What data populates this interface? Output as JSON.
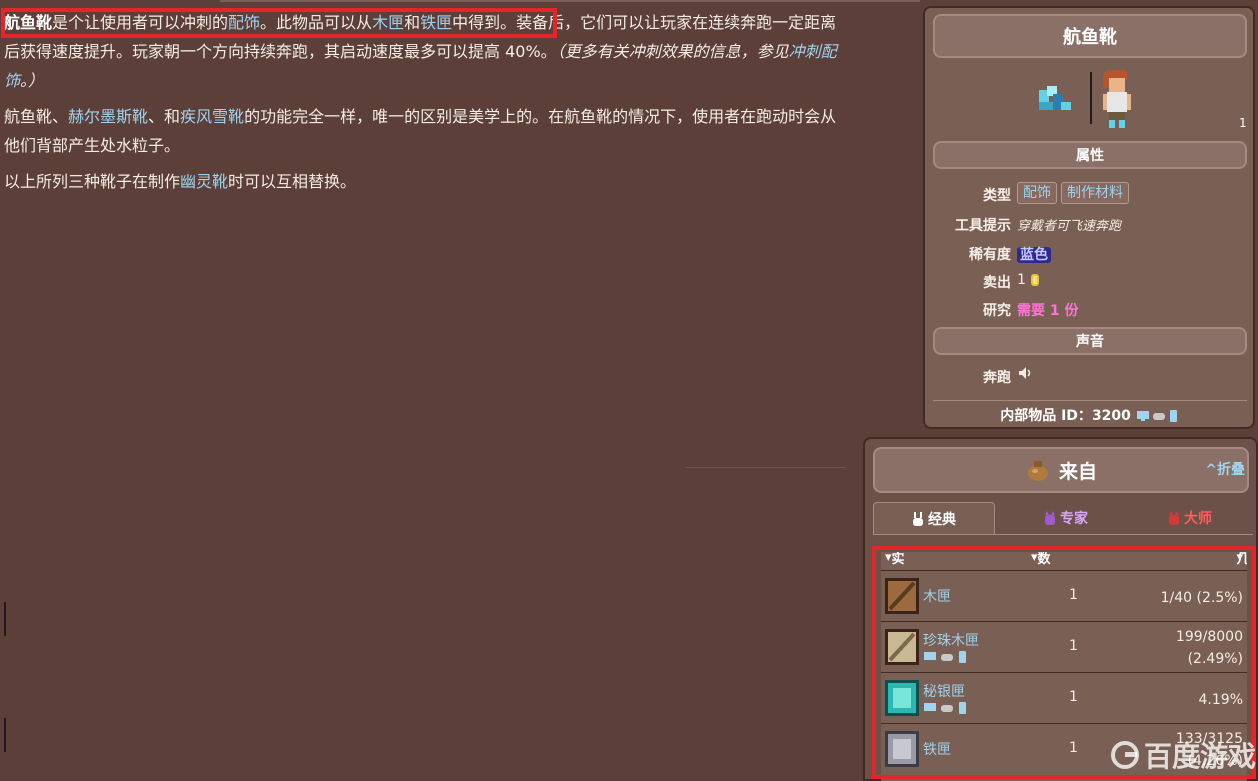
{
  "article": {
    "p1": {
      "item_name": "航鱼靴",
      "t1": "是个让使用者可以冲刺的",
      "link_accessory": "配饰",
      "t2": "。此物品可以从",
      "link_wooden_crate": "木匣",
      "t3": "和",
      "link_iron_crate": "铁匣",
      "t4": "中得到。装备后，它们可以让玩家在连续奔跑一定距离后获得速度提升。玩家朝一个方向持续奔跑，其启动速度最多可以提高 40%。",
      "note_prefix": "（更多有关冲刺效果的信息，参见",
      "note_link": "冲刺配饰",
      "note_suffix": "。）"
    },
    "p2": {
      "t1": "航鱼靴、",
      "link_hermes": "赫尔墨斯靴",
      "t2": "、和",
      "link_flurry": "疾风雪靴",
      "t3": "的功能完全一样，唯一的区别是美学上的。在航鱼靴的情况下，使用者在跑动时会从他们背部产生处水粒子。"
    },
    "p3": {
      "t1": "以上所列三种靴子在制作",
      "link_spectre": "幽灵靴",
      "t2": "时可以互相替换。"
    }
  },
  "infobox": {
    "title": "航鱼靴",
    "images_note": "1",
    "section_props": "属性",
    "type_label": "类型",
    "type_tags": [
      "配饰",
      "制作材料"
    ],
    "tooltip_label": "工具提示",
    "tooltip_value": "穿戴者可飞速奔跑",
    "rarity_label": "稀有度",
    "rarity_value": "蓝色",
    "sell_label": "卖出",
    "sell_value": "1",
    "research_label": "研究",
    "research_value": "需要 1 份",
    "section_sound": "声音",
    "sound_label": "奔跑",
    "id_label": "内部物品 ID：",
    "id_value": "3200"
  },
  "dropbox": {
    "title": "来自",
    "collapse": "^折叠",
    "tabs": [
      "经典",
      "专家",
      "大师"
    ],
    "headers": [
      "实体",
      "数量",
      "几率"
    ],
    "rows": [
      {
        "name": "木匣",
        "qty": "1",
        "rate1": "1/40 (2.5%)",
        "rate2": ""
      },
      {
        "name": "珍珠木匣",
        "qty": "1",
        "rate1": "199/8000",
        "rate2": "(2.49%)"
      },
      {
        "name": "秘银匣",
        "qty": "1",
        "rate1": "4.19%",
        "rate2": ""
      },
      {
        "name": "铁匣",
        "qty": "1",
        "rate1": "133/3125",
        "rate2": "(4.26%)"
      }
    ]
  },
  "watermark": "百度游戏",
  "colors": {
    "background": "#5c3f38",
    "link": "#9fd3ee",
    "highlight": "#e2262b",
    "research": "#ff74d9",
    "rarity_blue": "#2d2a8f"
  }
}
